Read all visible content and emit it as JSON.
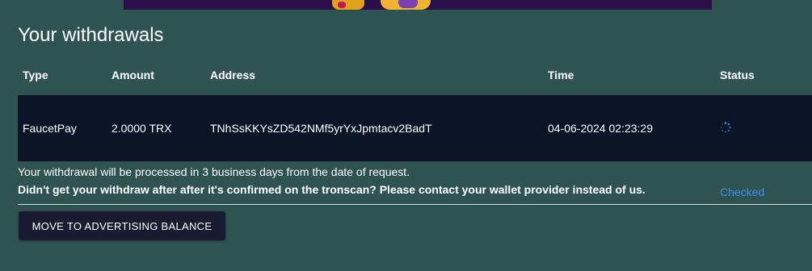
{
  "section": {
    "title": "Your withdrawals"
  },
  "table": {
    "headers": {
      "type": "Type",
      "amount": "Amount",
      "address": "Address",
      "time": "Time",
      "status": "Status"
    },
    "rows": [
      {
        "type": "FaucetPay",
        "amount": "2.0000 TRX",
        "address": "TNhSsKKYsZD542NMf5yrYxJpmtacv2BadT",
        "time": "04-06-2024 02:23:29",
        "status": "Checked",
        "status_icon": "spinner-icon"
      }
    ]
  },
  "notes": {
    "processing": "Your withdrawal will be processed in 3 business days from the date of request.",
    "contact": "Didn't get your withdraw after after it's confirmed on the tronscan? Please contact your wallet provider instead of us."
  },
  "actions": {
    "move_button_label": "MOVE TO ADVERTISING BALANCE"
  },
  "colors": {
    "page_background": "#2e5350",
    "row_background": "#0b1426",
    "status_color": "#3b8ef0",
    "button_background": "#1a1a33"
  }
}
